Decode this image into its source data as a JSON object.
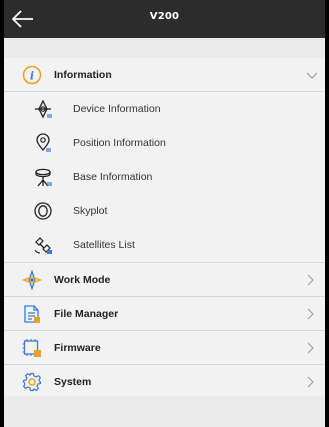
{
  "header": {
    "title": "V200"
  },
  "menu": {
    "information": {
      "label": "Information"
    },
    "sub_items": [
      {
        "label": "Device Information",
        "icon": "device-info-icon"
      },
      {
        "label": "Position Information",
        "icon": "position-info-icon"
      },
      {
        "label": "Base Information",
        "icon": "base-info-icon"
      },
      {
        "label": "Skyplot",
        "icon": "skyplot-icon"
      },
      {
        "label": "Satellites List",
        "icon": "satellites-list-icon"
      }
    ],
    "work_mode": {
      "label": "Work Mode"
    },
    "file_manager": {
      "label": "File Manager"
    },
    "firmware": {
      "label": "Firmware"
    },
    "system": {
      "label": "System"
    }
  },
  "colors": {
    "titlebar": "#2c2c2c",
    "accent_orange": "#f0a020",
    "accent_blue": "#3a7bd5",
    "row_bg": "#f2f2f2",
    "page_bg": "#ebebeb"
  }
}
